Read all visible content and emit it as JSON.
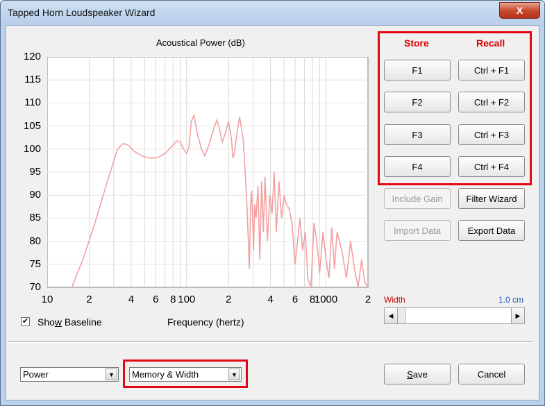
{
  "window": {
    "title": "Tapped Horn Loudspeaker Wizard",
    "close_label": "X"
  },
  "chart": {
    "title": "Acoustical Power (dB)",
    "xlabel": "Frequency (hertz)",
    "y_ticks": [
      "120",
      "115",
      "110",
      "105",
      "100",
      "95",
      "90",
      "85",
      "80",
      "75",
      "70"
    ],
    "x_ticks": [
      "10",
      "2",
      "4",
      "6",
      "8",
      "100",
      "2",
      "4",
      "6",
      "8",
      "1000",
      "2"
    ]
  },
  "chart_data": {
    "type": "line",
    "title": "Acoustical Power (dB)",
    "xlabel": "Frequency (hertz)",
    "ylabel": "",
    "x_scale": "log",
    "xlim": [
      10,
      2000
    ],
    "ylim": [
      70,
      120
    ],
    "grid": true,
    "series": [
      {
        "color": "#f4a0a0",
        "x": [
          15,
          18,
          22,
          27,
          32,
          35,
          38,
          42,
          48,
          55,
          62,
          70,
          78,
          85,
          90,
          95,
          100,
          104,
          108,
          113,
          120,
          128,
          135,
          145,
          155,
          165,
          172,
          180,
          190,
          200,
          210,
          215,
          220,
          230,
          240,
          255,
          270,
          282,
          288,
          293,
          297,
          302,
          308,
          315,
          325,
          335,
          345,
          355,
          365,
          380,
          395,
          410,
          425,
          440,
          460,
          480,
          500,
          520,
          545,
          570,
          600,
          625,
          650,
          680,
          710,
          740,
          780,
          820,
          860,
          900,
          950,
          1000,
          1050,
          1100,
          1150,
          1200,
          1300,
          1400,
          1500,
          1600,
          1700,
          1800,
          1900,
          2000
        ],
        "values": [
          70,
          76,
          84,
          93,
          100,
          101.2,
          100.9,
          99.5,
          98.5,
          98,
          98.2,
          99,
          100.5,
          101.8,
          101.5,
          100,
          99,
          100.5,
          106,
          107.3,
          103,
          100,
          98.5,
          101,
          104,
          106.3,
          104.5,
          101.5,
          103.5,
          106,
          102,
          98,
          99,
          103.5,
          107,
          102,
          89,
          74,
          88,
          91,
          86,
          78,
          88,
          85,
          92,
          76,
          93,
          82,
          94,
          80,
          90,
          86,
          95,
          82,
          93,
          85,
          90,
          88,
          87,
          84,
          75,
          80,
          85,
          78,
          82,
          72,
          70,
          84,
          80,
          73,
          82,
          76,
          72,
          83,
          74,
          82,
          78,
          72,
          80,
          74,
          70,
          76,
          71,
          70
        ]
      }
    ]
  },
  "storage": {
    "store_header": "Store",
    "recall_header": "Recall",
    "store_buttons": [
      "F1",
      "F2",
      "F3",
      "F4"
    ],
    "recall_buttons": [
      "Ctrl + F1",
      "Ctrl + F2",
      "Ctrl + F3",
      "Ctrl + F4"
    ]
  },
  "actions": {
    "include_gain": "Include Gain",
    "filter_wizard": "Filter Wizard",
    "import_data": "Import Data",
    "export_data": "Export Data"
  },
  "width_control": {
    "label": "Width",
    "value": "1.0 cm"
  },
  "baseline": {
    "label_pre": "Sho",
    "label_underlined": "w",
    "label_post": " Baseline",
    "checked": true
  },
  "bottom": {
    "mode_select": "Power",
    "memory_select": "Memory & Width",
    "save_label_underlined": "S",
    "save_label_rest": "ave",
    "cancel_label": "Cancel"
  },
  "colors": {
    "highlight": "#e30613",
    "curve": "#f4a0a0",
    "store_recall": "#e00000",
    "width_label": "#c00000",
    "width_value": "#1c5bbd"
  }
}
